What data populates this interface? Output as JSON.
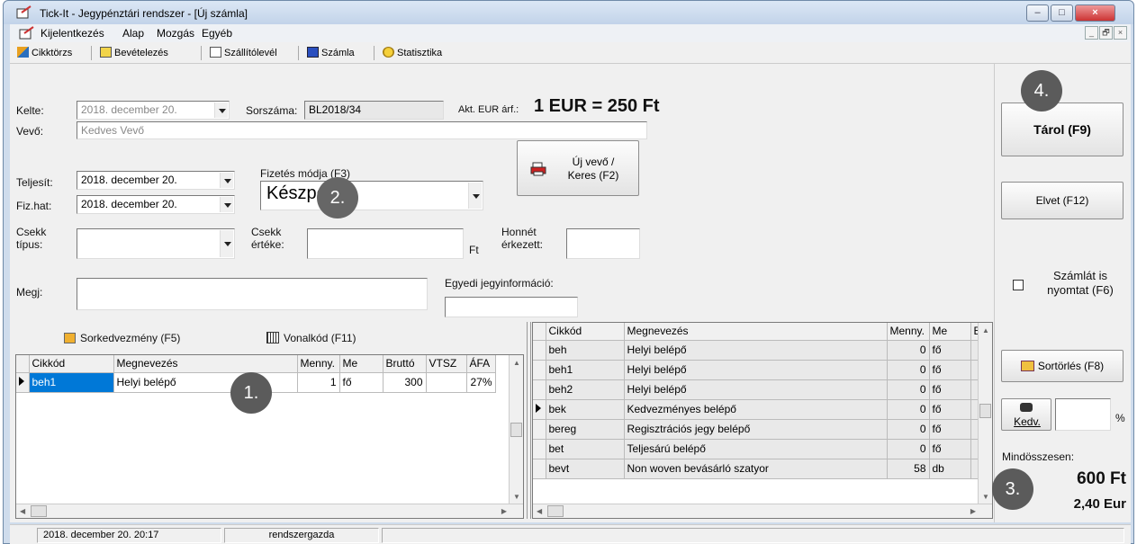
{
  "window": {
    "title": "Tick-It  -  Jegypénztári rendszer - [Új számla]",
    "minimize": "–",
    "maximize": "□",
    "close": "×"
  },
  "menu": [
    "Kijelentkezés",
    "Alap",
    "Mozgás",
    "Egyéb"
  ],
  "mdi": {
    "minimize": "_",
    "restore": "🗗",
    "close": "×"
  },
  "toolbar": [
    "Cikktörzs",
    "Bevételezés",
    "Szállítólevél",
    "Számla",
    "Statisztika"
  ],
  "form": {
    "kelte_label": "Kelte:",
    "kelte_value": "2018.  december  20.",
    "sorszama_label": "Sorszáma:",
    "sorszama_value": "BL2018/34",
    "eur_label": "Akt. EUR árf.:",
    "eur_value": "1 EUR = 250 Ft",
    "vevo_label": "Vevő:",
    "vevo_value": "Kedves Vevő",
    "teljesit_label": "Teljesít:",
    "teljesit_value": "2018.  december  20.",
    "fizhat_label": "Fiz.hat:",
    "fizhat_value": "2018.  december  20.",
    "fizetes_label": "Fizetés módja (F3)",
    "fizetes_value": "Készpénz",
    "uj_vevo_line1": "Új vevő /",
    "uj_vevo_line2": "Keres (F2)",
    "csekk_tipus_line1": "Csekk",
    "csekk_tipus_line2": "típus:",
    "csekk_erteke_line1": "Csekk",
    "csekk_erteke_line2": "értéke:",
    "ft_label": "Ft",
    "honnet_line1": "Honnét",
    "honnet_line2": "érkezett:",
    "megj_label": "Megj:",
    "egyedi_label": "Egyedi jegyinformáció:",
    "sorkedvezmeny": "Sorkedvezmény (F5)",
    "vonalkod": "Vonalkód (F11)"
  },
  "left_grid": {
    "headers": [
      "Cikkód",
      "Megnevezés",
      "Menny.",
      "Me",
      "Bruttó",
      "VTSZ",
      "ÁFA"
    ],
    "rows": [
      {
        "code": "beh1",
        "name": "Helyi belépő",
        "qty": "1",
        "unit": "fő",
        "gross": "300",
        "vtsz": "",
        "vat": "27%"
      }
    ]
  },
  "right_grid": {
    "headers": [
      "Cikkód",
      "Megnevezés",
      "Menny.",
      "Me",
      "E"
    ],
    "rows": [
      {
        "code": "beh",
        "name": "Helyi belépő",
        "qty": "0",
        "unit": "fő"
      },
      {
        "code": "beh1",
        "name": "Helyi belépő",
        "qty": "0",
        "unit": "fő"
      },
      {
        "code": "beh2",
        "name": "Helyi belépő",
        "qty": "0",
        "unit": "fő"
      },
      {
        "code": "bek",
        "name": "Kedvezményes belépő",
        "qty": "0",
        "unit": "fő"
      },
      {
        "code": "bereg",
        "name": "Regisztrációs jegy belépő",
        "qty": "0",
        "unit": "fő"
      },
      {
        "code": "bet",
        "name": "Teljesárú belépő",
        "qty": "0",
        "unit": "fő"
      },
      {
        "code": "bevt",
        "name": "Non woven bevásárló szatyor",
        "qty": "58",
        "unit": "db"
      }
    ]
  },
  "side": {
    "tarol": "Tárol (F9)",
    "elvet": "Elvet (F12)",
    "print_line1": "Számlát is",
    "print_line2": "nyomtat  (F6)",
    "sortorles": "Sortörlés (F8)",
    "kedv": "Kedv.",
    "percent": "%",
    "total_label": "Mindösszesen:",
    "total_ft": "600 Ft",
    "total_eur": "2,40 Eur"
  },
  "badges": [
    "1.",
    "2.",
    "3.",
    "4."
  ],
  "status": {
    "datetime": "2018. december 20.   20:17",
    "user": "rendszergazda"
  }
}
